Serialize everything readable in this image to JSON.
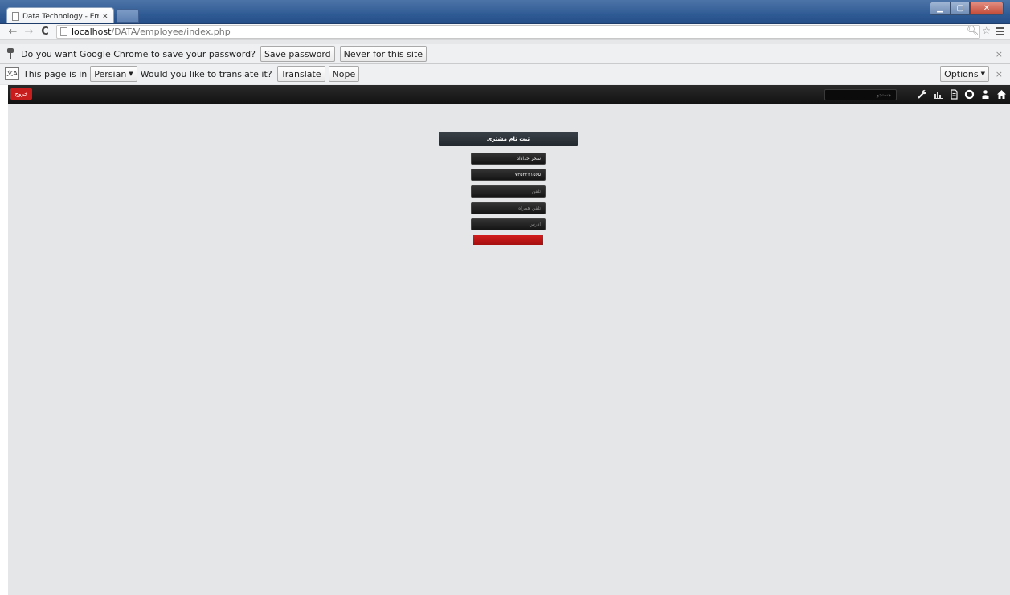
{
  "browser": {
    "tab_title": "Data Technology - Emplo",
    "tab_close": "×",
    "url_host": "localhost",
    "url_path": "/DATA/employee/index.php",
    "back_icon": "←",
    "forward_icon": "→",
    "reload_icon": "C"
  },
  "password_bar": {
    "message": "Do you want Google Chrome to save your password?",
    "save_label": "Save password",
    "never_label": "Never for this site",
    "close": "×"
  },
  "translate_bar": {
    "prefix": "This page is in",
    "language": "Persian",
    "question": "Would you like to translate it?",
    "translate_label": "Translate",
    "nope_label": "Nope",
    "options_label": "Options",
    "close": "×"
  },
  "app_toolbar": {
    "exit_label": "خروج",
    "search_placeholder": "جستجو",
    "icons": [
      "wrench-icon",
      "chart-icon",
      "document-icon",
      "settings-icon",
      "user-icon",
      "home-icon"
    ]
  },
  "form": {
    "title": "ثبت نام مشتری",
    "fields": [
      {
        "name": "customer-name",
        "value": "سحر خداداد",
        "placeholder": ""
      },
      {
        "name": "phone",
        "value": "۷۳۵۲۲۴۱۵۶۵",
        "placeholder": ""
      },
      {
        "name": "mobile",
        "value": "",
        "placeholder": "تلفن"
      },
      {
        "name": "workplace",
        "value": "",
        "placeholder": "تلفن همراه"
      },
      {
        "name": "address",
        "value": "",
        "placeholder": "آدرس"
      }
    ],
    "submit_color": "#c41717"
  }
}
